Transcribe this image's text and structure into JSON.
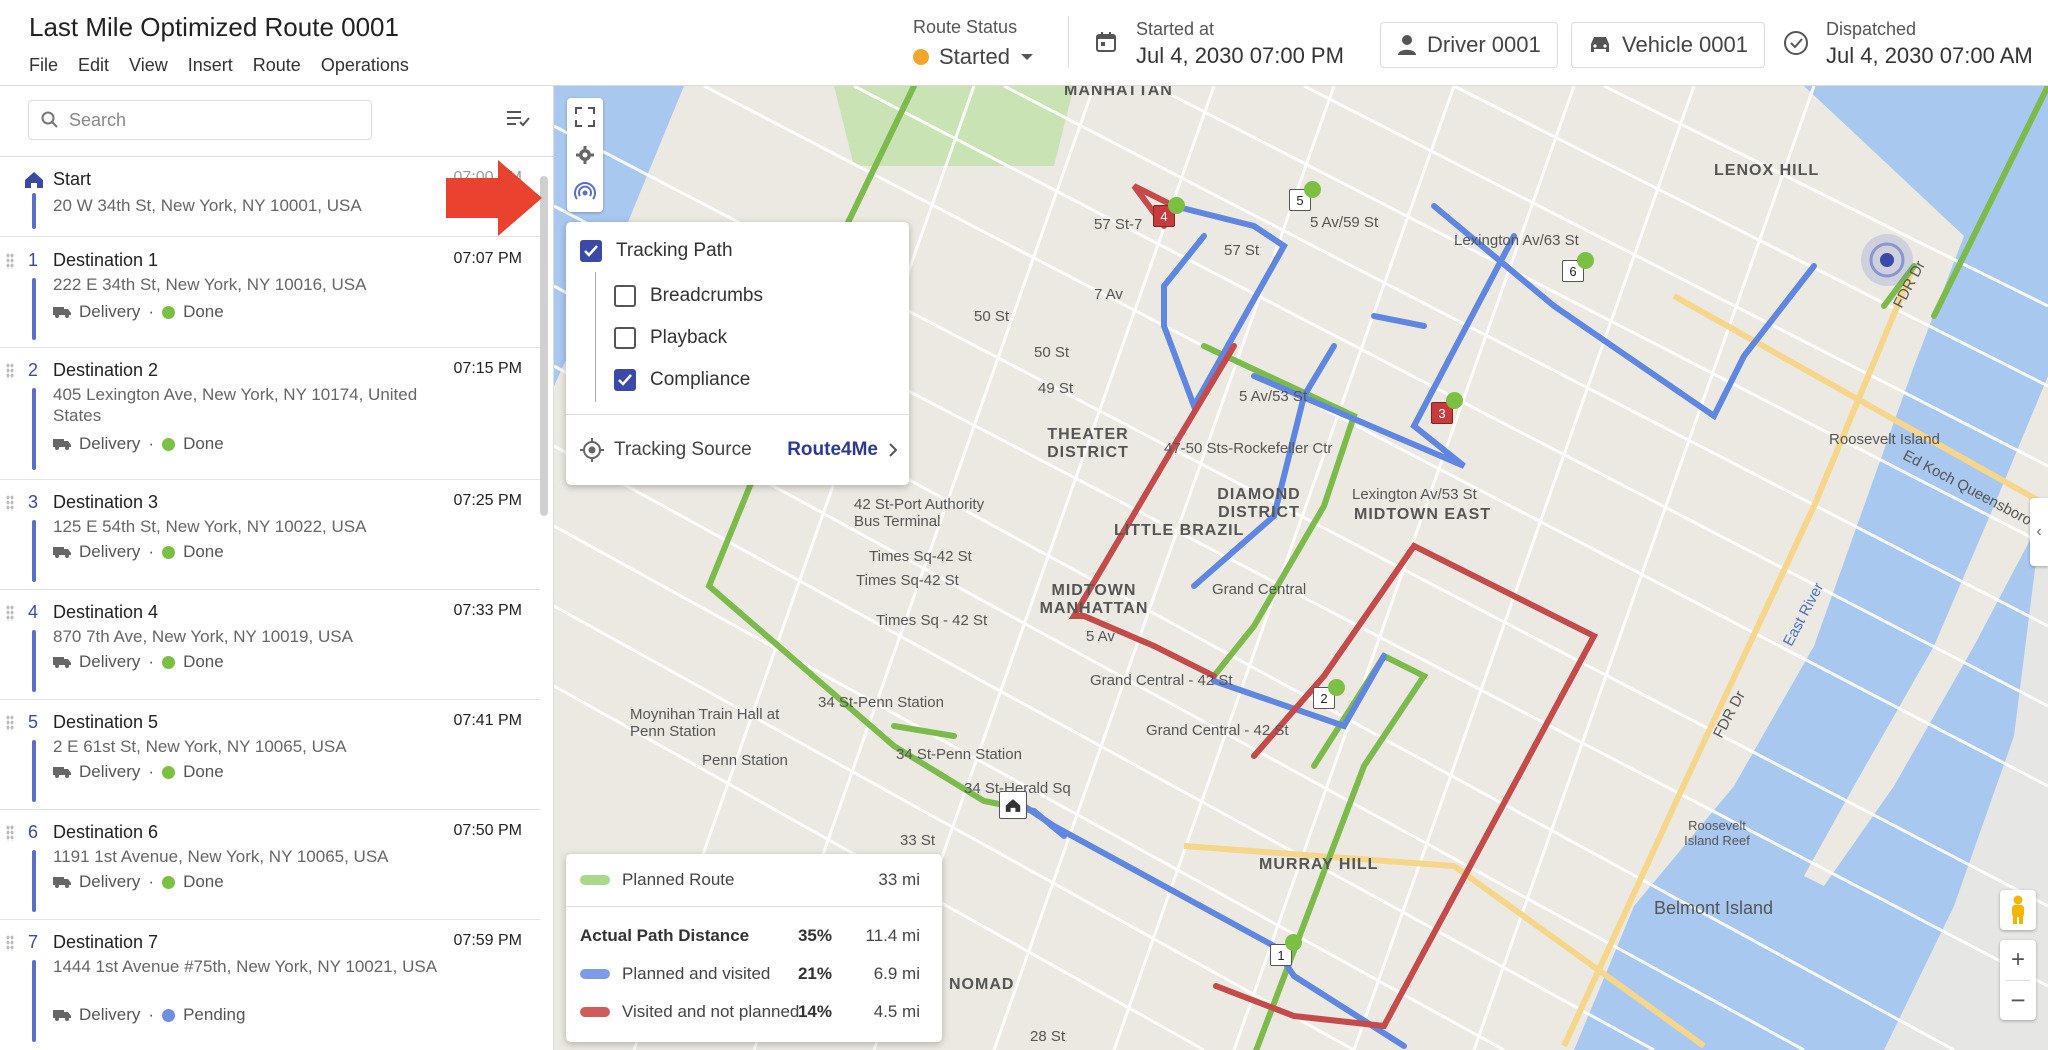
{
  "header": {
    "title": "Last Mile Optimized Route 0001",
    "menu": [
      "File",
      "Edit",
      "View",
      "Insert",
      "Route",
      "Operations"
    ],
    "route_status_label": "Route Status",
    "route_status_value": "Started",
    "started_label": "Started at",
    "started_value": "Jul 4, 2030 07:00 PM",
    "driver": "Driver 0001",
    "vehicle": "Vehicle 0001",
    "dispatched_label": "Dispatched",
    "dispatched_value": "Jul 4, 2030 07:00 AM",
    "status_color": "#f4a62a"
  },
  "sidebar": {
    "search_placeholder": "Search",
    "start": {
      "label": "Start",
      "address": "20 W 34th St, New York, NY 10001, USA",
      "time": "07:00 PM"
    },
    "stops": [
      {
        "num": "1",
        "name": "Destination 1",
        "address": "222 E 34th St, New York, NY 10016, USA",
        "time": "07:07 PM",
        "type": "Delivery",
        "status": "Done"
      },
      {
        "num": "2",
        "name": "Destination 2",
        "address": "405 Lexington Ave, New York, NY 10174, United States",
        "time": "07:15 PM",
        "type": "Delivery",
        "status": "Done"
      },
      {
        "num": "3",
        "name": "Destination 3",
        "address": "125 E 54th St, New York, NY 10022, USA",
        "time": "07:25 PM",
        "type": "Delivery",
        "status": "Done"
      },
      {
        "num": "4",
        "name": "Destination 4",
        "address": "870 7th Ave, New York, NY 10019, USA",
        "time": "07:33 PM",
        "type": "Delivery",
        "status": "Done"
      },
      {
        "num": "5",
        "name": "Destination 5",
        "address": "2 E 61st St, New York, NY 10065, USA",
        "time": "07:41 PM",
        "type": "Delivery",
        "status": "Done"
      },
      {
        "num": "6",
        "name": "Destination 6",
        "address": "1191 1st Avenue, New York, NY 10065, USA",
        "time": "07:50 PM",
        "type": "Delivery",
        "status": "Done"
      },
      {
        "num": "7",
        "name": "Destination 7",
        "address": "1444 1st Avenue #75th, New York, NY 10021, USA",
        "time": "07:59 PM",
        "type": "Delivery",
        "status": "Pending"
      }
    ]
  },
  "tracking_popup": {
    "tracking_path": "Tracking Path",
    "breadcrumbs": "Breadcrumbs",
    "playback": "Playback",
    "compliance": "Compliance",
    "source_label": "Tracking Source",
    "source_value": "Route4Me"
  },
  "legend": {
    "planned_route": "Planned Route",
    "planned_route_distance": "33 mi",
    "actual_title": "Actual Path Distance",
    "actual_pct": "35%",
    "actual_distance": "11.4 mi",
    "planned_visited": "Planned and visited",
    "planned_visited_pct": "21%",
    "planned_visited_distance": "6.9 mi",
    "visited_not_planned": "Visited and not planned",
    "visited_not_planned_pct": "14%",
    "visited_not_planned_distance": "4.5 mi",
    "colors": {
      "planned": "#a9d88a",
      "visited": "#6e8ee3",
      "not_planned": "#d15b5b"
    }
  },
  "map_labels": {
    "manhattan": "MANHATTAN",
    "lenox_hill": "LENOX HILL",
    "theater_district": "THEATER DISTRICT",
    "diamond_district": "DIAMOND DISTRICT",
    "little_brazil": "LITTLE BRAZIL",
    "midtown_east": "MIDTOWN EAST",
    "midtown_manhattan": "MIDTOWN MANHATTAN",
    "murray_hill": "MURRAY HILL",
    "nomad": "NOMAD",
    "roosevelt_island": "Roosevelt Island",
    "belmont_island": "Belmont Island",
    "east_river": "East River",
    "times_sq1": "Times Sq-42 St",
    "times_sq2": "Times Sq-42 St",
    "times_sq3": "Times Sq - 42 St",
    "port_authority": "42 St-Port Authority Bus Terminal",
    "grand_central1": "Grand Central - 42 St",
    "grand_central2": "Grand Central - 42 St",
    "grand_central3": "Grand Central",
    "penn_station": "Penn Station",
    "moynihan": "Moynihan Train Hall at Penn Station",
    "st34_penn1": "34 St-Penn Station",
    "st34_penn2": "34 St-Penn Station",
    "herald_sq": "34 St-Herald Sq",
    "st33": "33 St",
    "st28": "28 St",
    "lex63": "Lexington Av/63 St",
    "lex53": "Lexington Av/53 St",
    "av59": "5 Av/59 St",
    "av53": "5 Av/53 St",
    "st57_7": "57 St-7",
    "st57": "57 St",
    "av7": "7 Av",
    "st50": "50 St",
    "st49": "49 St",
    "sts47_50": "47-50 Sts-Rockefeller Ctr",
    "av5": "5 Av",
    "ed_koch": "Ed Koch Queensboro Brg",
    "roosevelt_reef": "Roosevelt Island Reef",
    "fdr": "FDR Dr"
  }
}
